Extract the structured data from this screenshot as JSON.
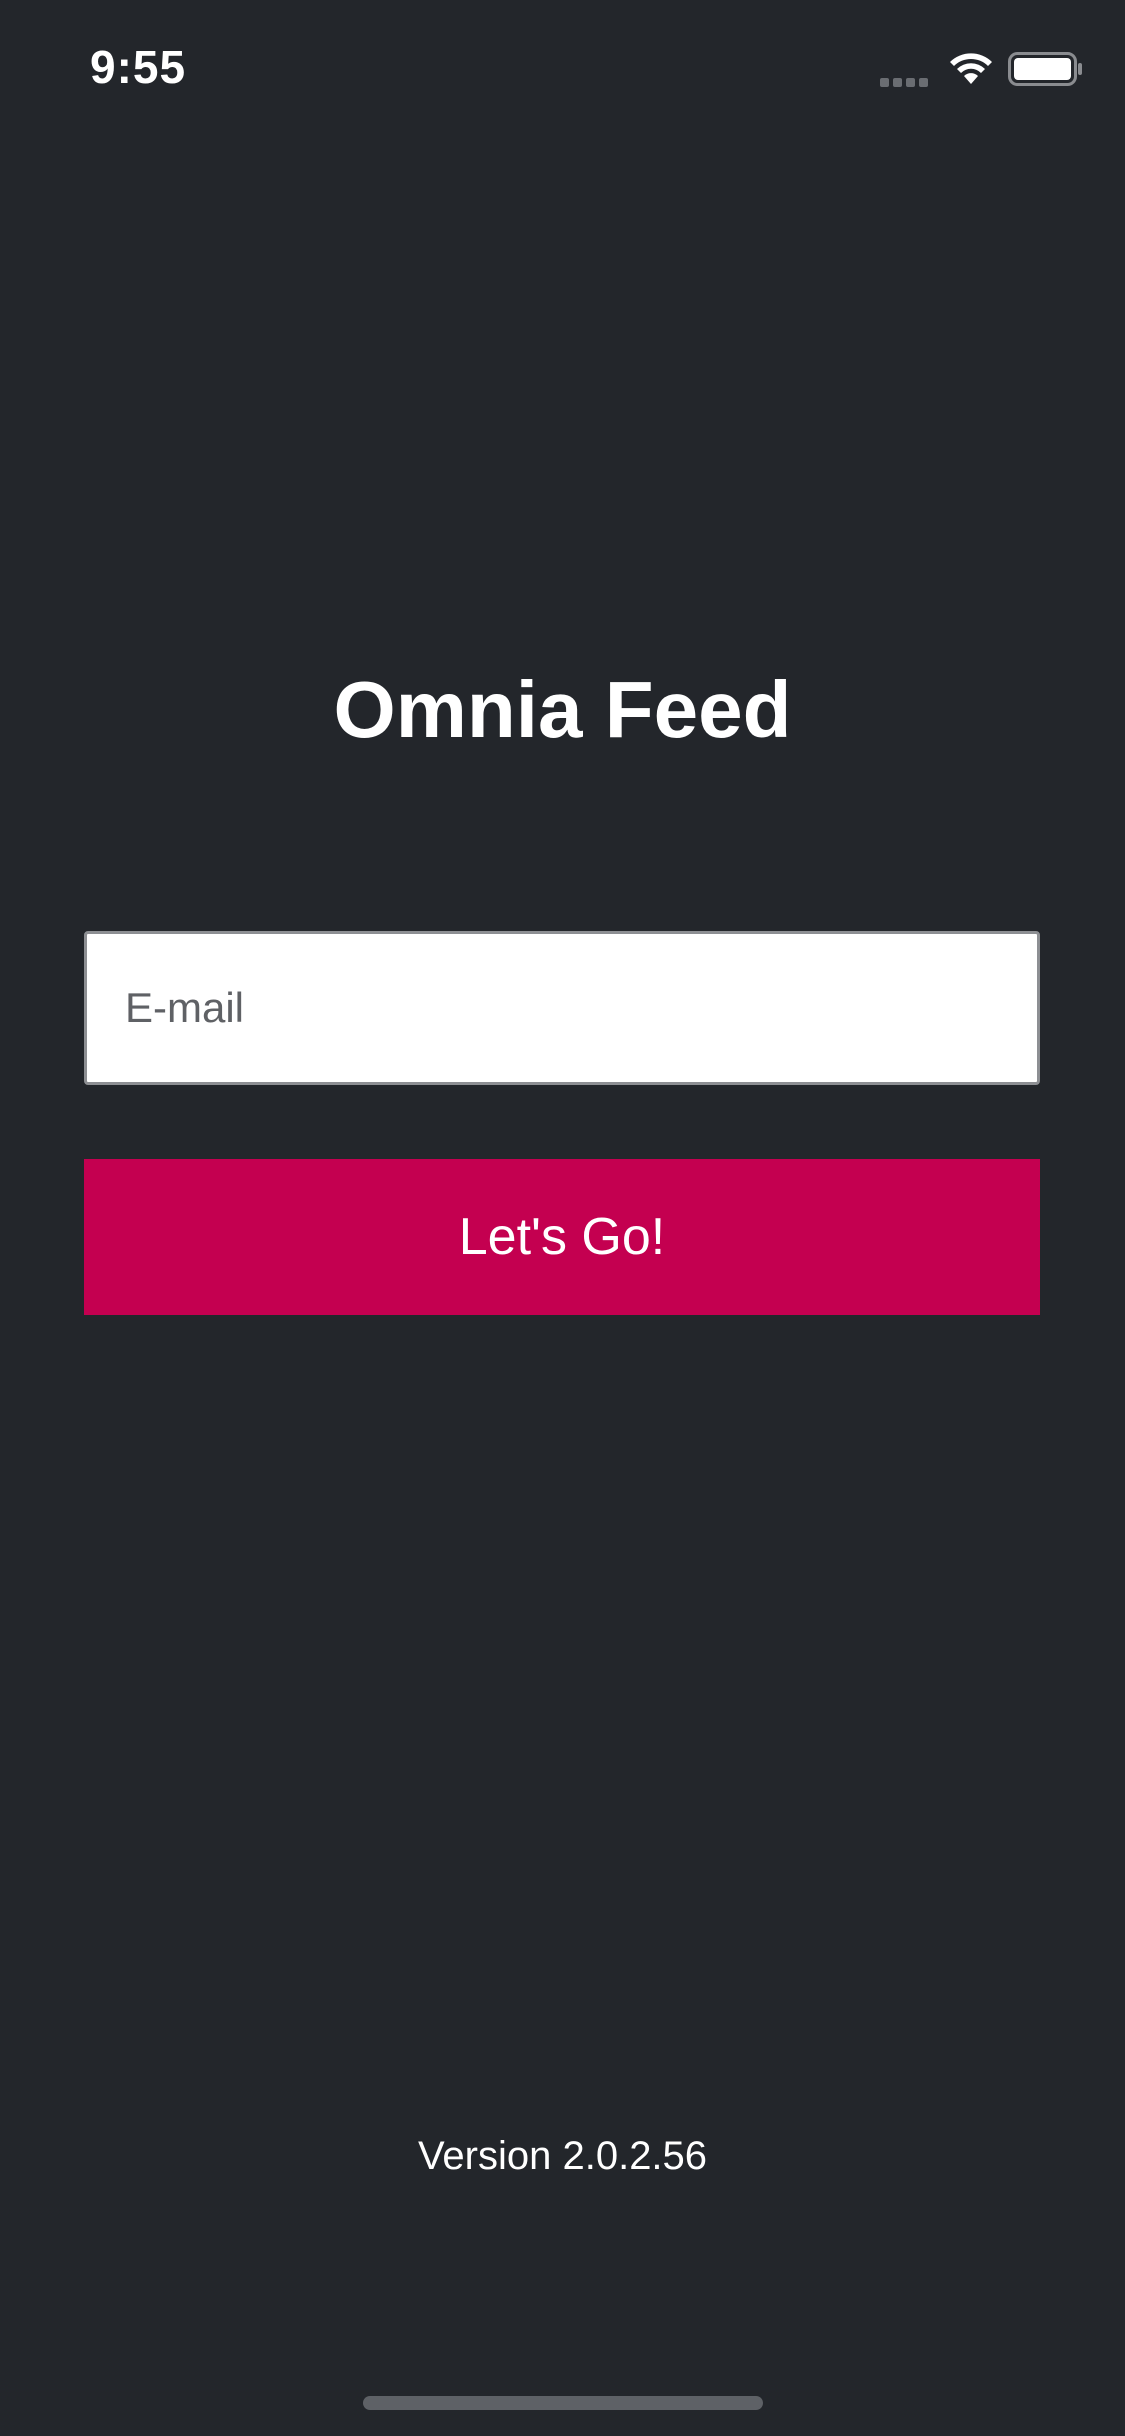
{
  "status_bar": {
    "time": "9:55",
    "icons": [
      "signal-icon",
      "wifi-icon",
      "battery-icon"
    ]
  },
  "login": {
    "title": "Omnia Feed",
    "email_placeholder": "E-mail",
    "email_value": "",
    "submit_label": "Let's Go!"
  },
  "footer": {
    "version": "Version 2.0.2.56"
  },
  "colors": {
    "background": "#23262b",
    "accent": "#c40050",
    "text": "#ffffff"
  }
}
